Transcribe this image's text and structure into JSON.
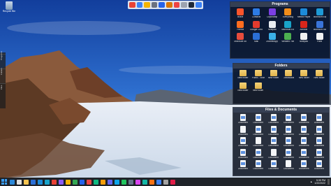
{
  "desktop": {
    "recycle_bin": "Recycle Bin"
  },
  "left_sidebar": [
    "Programs",
    "Folders",
    "Files"
  ],
  "fences": {
    "programs": {
      "title": "Programs",
      "items": [
        {
          "label": "Brave",
          "icon": "brave-icon",
          "color": "#fb542b"
        },
        {
          "label": "Contacts",
          "icon": "contacts-icon",
          "color": "#2d7be5"
        },
        {
          "label": "Clipchamp",
          "icon": "clipchamp-icon",
          "color": "#7b3fe4"
        },
        {
          "label": "Everything",
          "icon": "search-icon",
          "color": "#f08c1a"
        },
        {
          "label": "Media Player",
          "icon": "media-player-icon",
          "color": "#1c8ad8"
        },
        {
          "label": "Microsoft Edge Beta",
          "icon": "edge-beta-icon",
          "color": "#1e9ad6"
        },
        {
          "label": "Firefox",
          "icon": "firefox-icon",
          "color": "#ff6d1f"
        },
        {
          "label": "Google Chrome",
          "icon": "chrome-icon",
          "color": "#e33b2e"
        },
        {
          "label": "Notepad",
          "icon": "notepad-icon",
          "color": "#e9edf2"
        },
        {
          "label": "Microsoft Edge",
          "icon": "edge-icon",
          "color": "#19a3c9"
        },
        {
          "label": "Acrobat",
          "icon": "acrobat-icon",
          "color": "#d8261b"
        },
        {
          "label": "Microsoft Store",
          "icon": "store-icon",
          "color": "#3a74d9"
        },
        {
          "label": "Microsoft Store",
          "icon": "store-icon",
          "color": "#e84c3d"
        },
        {
          "label": "Mail",
          "icon": "mail-icon",
          "color": "#2b6fd6"
        },
        {
          "label": "OMWebApp Monitor",
          "icon": "app-icon",
          "color": "#3bb0e8"
        },
        {
          "label": "Winaero Tweaker",
          "icon": "tweaker-icon",
          "color": "#4caf50"
        },
        {
          "label": "Notepad",
          "icon": "notepad-icon",
          "color": "#f0f0f0"
        },
        {
          "label": "Paint",
          "icon": "paint-icon",
          "color": "#f2f2f2"
        }
      ]
    },
    "folders": {
      "title": "Folders",
      "items": [
        {
          "label": "New folder"
        },
        {
          "label": "Public - Shared folder"
        },
        {
          "label": "New folder"
        },
        {
          "label": "Downloads"
        },
        {
          "label": "New folder"
        },
        {
          "label": "New folder"
        },
        {
          "label": "New folder"
        },
        {
          "label": "New folder"
        }
      ]
    },
    "docs": {
      "title": "Files & Documents",
      "items": [
        {
          "label": "Document"
        },
        {
          "label": "Document"
        },
        {
          "label": "Document"
        },
        {
          "label": "Document"
        },
        {
          "label": "Document"
        },
        {
          "label": "Document"
        },
        {
          "label": "Document"
        },
        {
          "label": "Document"
        },
        {
          "label": "Document"
        },
        {
          "label": "Document"
        },
        {
          "label": "Document"
        },
        {
          "label": "Document"
        },
        {
          "label": "Document"
        },
        {
          "label": "Document"
        },
        {
          "label": "Document"
        },
        {
          "label": "Document"
        },
        {
          "label": "Document"
        },
        {
          "label": "Document"
        },
        {
          "label": "Document"
        },
        {
          "label": "Document"
        },
        {
          "label": "Document"
        },
        {
          "label": "Document"
        },
        {
          "label": "Document"
        },
        {
          "label": "Document"
        },
        {
          "label": "Document"
        },
        {
          "label": "Document"
        },
        {
          "label": "Document"
        },
        {
          "label": "Document"
        },
        {
          "label": "Document"
        },
        {
          "label": "Document"
        }
      ]
    }
  },
  "top_toolbar": [
    "#e94235",
    "#3b82f6",
    "#f4b400",
    "#6b7280",
    "#2563eb",
    "#d97706",
    "#ef4444",
    "#9ca3af",
    "#1f2937",
    "#3b82f6"
  ],
  "taskbar": {
    "apps": [
      "#2b88d8",
      "#e0e0e0",
      "#f5c451",
      "#2b6fd6",
      "#1c8ad8",
      "#19a3c9",
      "#e94235",
      "#8b5cf6",
      "#f4b400",
      "#34a853",
      "#2563eb",
      "#ef4444",
      "#10b981",
      "#f59e0b",
      "#6366f1",
      "#0ea5e9",
      "#22c55e",
      "#64748b",
      "#d946ef",
      "#14b8a6",
      "#f97316",
      "#3b82f6",
      "#a3a3a3",
      "#e11d48"
    ],
    "clock_time": "5:39 PM",
    "clock_date": "1/22/2022"
  }
}
